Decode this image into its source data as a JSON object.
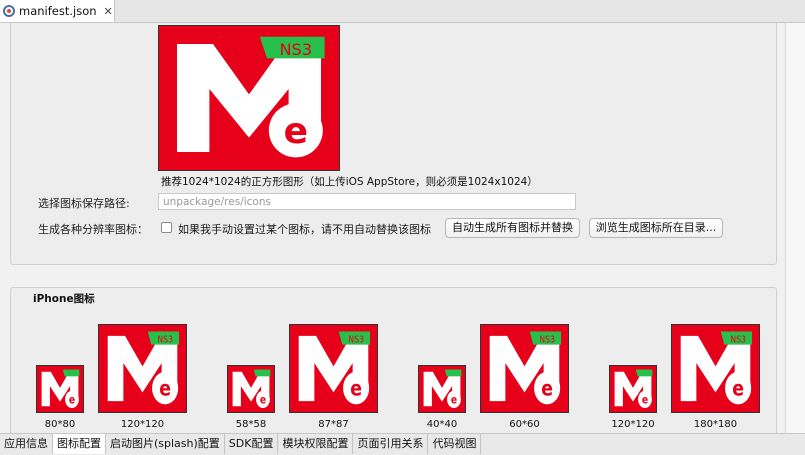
{
  "tab": {
    "file_name": "manifest.json",
    "close_glyph": "✕",
    "icon": "manifest-file-icon"
  },
  "logo": {
    "badge_text": "NS3",
    "brand_color": "#e6001a",
    "badge_color": "#27c04a"
  },
  "preview_caption": "推荐1024*1024的正方形图形（如上传iOS AppStore，则必须是1024x1024）",
  "path_row": {
    "label": "选择图标保存路径:",
    "placeholder": "unpackage/res/icons",
    "value": ""
  },
  "resolution_row": {
    "label": "生成各种分辨率图标：",
    "checkbox_label": "如果我手动设置过某个图标，请不用自动替换该图标",
    "checked": false,
    "generate_button": "自动生成所有图标并替换",
    "browse_button": "浏览生成图标所在目录..."
  },
  "iphone_group": {
    "title": "iPhone图标",
    "icons": [
      {
        "size_label": "80*80",
        "variant": "small"
      },
      {
        "size_label": "120*120",
        "variant": "large"
      },
      {
        "size_label": "58*58",
        "variant": "small"
      },
      {
        "size_label": "87*87",
        "variant": "large"
      },
      {
        "size_label": "40*40",
        "variant": "small"
      },
      {
        "size_label": "60*60",
        "variant": "large"
      },
      {
        "size_label": "120*120",
        "variant": "small"
      },
      {
        "size_label": "180*180",
        "variant": "large"
      }
    ]
  },
  "bottom_tabs": [
    {
      "label": "应用信息",
      "active": false
    },
    {
      "label": "图标配置",
      "active": true
    },
    {
      "label": "启动图片(splash)配置",
      "active": false
    },
    {
      "label": "SDK配置",
      "active": false
    },
    {
      "label": "模块权限配置",
      "active": false
    },
    {
      "label": "页面引用关系",
      "active": false
    },
    {
      "label": "代码视图",
      "active": false
    }
  ]
}
